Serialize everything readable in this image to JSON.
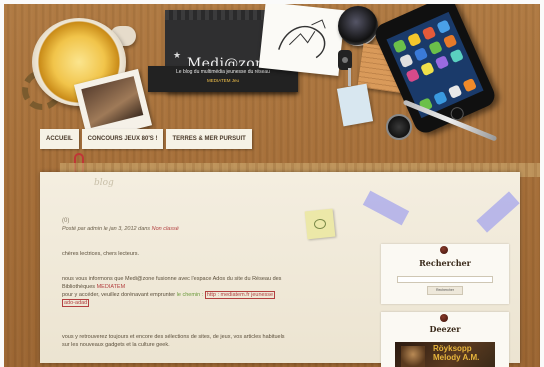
{
  "site": {
    "title": "Medi@zone",
    "tagline": "Le blog du multimédia jeunesse du réseau",
    "tagline_sub": "MEDIATEM Jeu"
  },
  "nav": {
    "items": [
      {
        "label": "ACCUEIL"
      },
      {
        "label": "CONCOURS JEUX 80'S !"
      },
      {
        "label": "TERRES & MER PURSUIT"
      }
    ]
  },
  "post": {
    "scribble": "blog",
    "comments": "(0)",
    "meta_prefix": "Posté par admin le jan 3, 2012 dans ",
    "category": "Non classé",
    "greeting": "chères lectrices, chers lecteurs.",
    "p2_a": "nous vous informons que Medi@zone fusionne avec l'espace Ados du site du Réseau des",
    "p2_b": "Bibliothèques ",
    "p2_network": "MEDIATEM",
    "p3_a": "pour y accéder, veuillez dorénavant emprunter ",
    "p3_path": "le chemin : ",
    "p3_link": "http : mediatem.fr jeunesse",
    "p3_link2": "ado-adad",
    "p4_a": "vous y retrouverez toujours et encore des sélections de sites, de jeux, vos articles habituels",
    "p4_b": "sur les nouveaux gadgets et la culture geek."
  },
  "sidebar": {
    "search_title": "Rechercher",
    "search_button": "Rechercher",
    "deezer_title": "Deezer",
    "deezer_artist": "Röyksopp",
    "deezer_album": "Melody A.M."
  },
  "colors": {
    "wood": "#a8753f",
    "paper": "#f1ead9",
    "accent_red": "#b34040",
    "nav_bg": "#f6f2e6",
    "tape": "#aaaaeb"
  },
  "icons": [
    "coffee-mug-icon",
    "paperclip-icon",
    "pushpin-icon",
    "smartphone-icon",
    "camera-lens-icon"
  ]
}
